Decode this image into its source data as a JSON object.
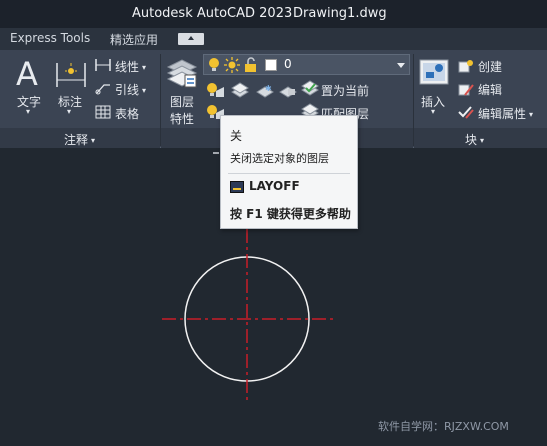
{
  "titlebar": {
    "app_title": "Autodesk AutoCAD 2023",
    "document_name": "Drawing1.dwg"
  },
  "ribbon_tabs": {
    "express_tools": "Express Tools",
    "featured_apps": "精选应用"
  },
  "annotation_panel": {
    "title": "注释",
    "text_label": "文字",
    "dimension_label": "标注",
    "linear_label": "线性",
    "leader_label": "引线",
    "table_label": "表格"
  },
  "layers_panel": {
    "properties_label_line1": "图层",
    "properties_label_line2": "特性",
    "current_layer": "0",
    "set_current_label": "置为当前",
    "match_layer_label": "匹配图层"
  },
  "block_panel": {
    "title": "块",
    "insert_label": "插入",
    "create_label": "创建",
    "edit_label": "编辑",
    "edit_attributes_label": "编辑属性"
  },
  "tooltip": {
    "title": "关",
    "description": "关闭选定对象的图层",
    "command": "LAYOFF",
    "help_hint": "按 F1 键获得更多帮助"
  },
  "watermark": "软件自学网：RJZXW.COM",
  "colors": {
    "crosshair": "#c81e28",
    "circle": "#ffffff",
    "bulb": "#f2c230"
  }
}
